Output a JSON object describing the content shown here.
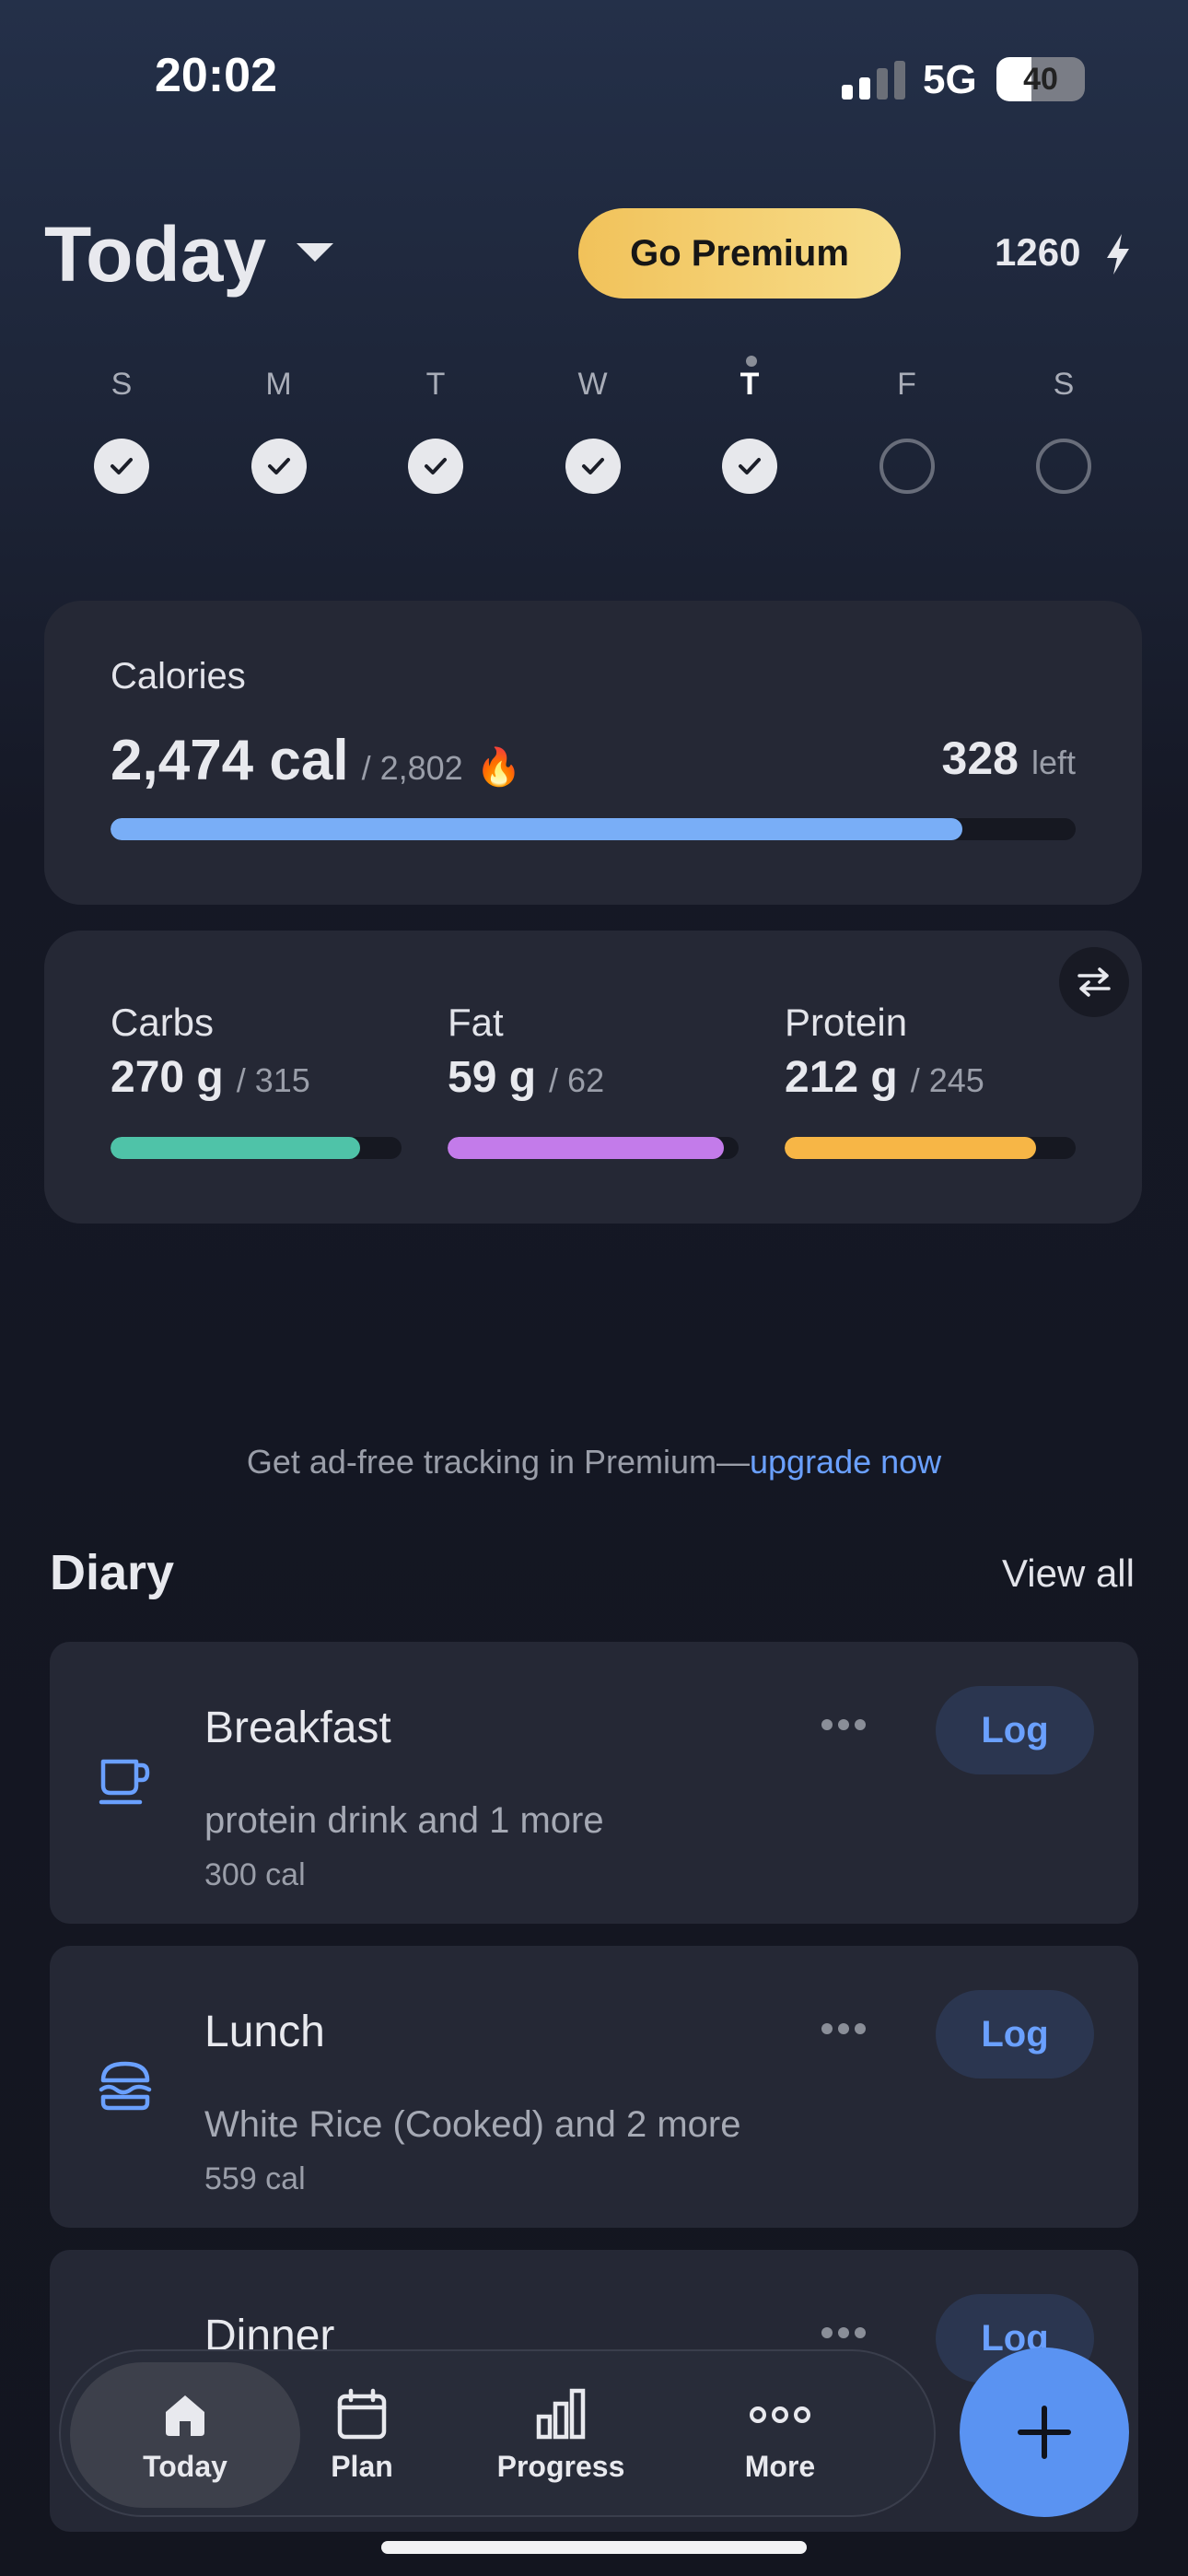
{
  "status_bar": {
    "time": "20:02",
    "network": "5G",
    "battery": "40",
    "battery_level": 0.4
  },
  "header": {
    "title": "Today",
    "premium_label": "Go Premium",
    "streak_count": "1260"
  },
  "week": {
    "days": [
      "S",
      "M",
      "T",
      "W",
      "T",
      "F",
      "S"
    ],
    "today_index": 4,
    "completed": [
      true,
      true,
      true,
      true,
      true,
      false,
      false
    ]
  },
  "calories": {
    "label": "Calories",
    "value": "2,474 cal",
    "goal": "/ 2,802",
    "icon": "flame-emoji",
    "left_value": "328",
    "left_label": "left",
    "progress": 0.883,
    "color": "#79aef7"
  },
  "macros": [
    {
      "name": "Carbs",
      "value": "270 g",
      "goal": "/ 315",
      "progress": 0.857,
      "color": "#4fc3a8"
    },
    {
      "name": "Fat",
      "value": "59 g",
      "goal": "/ 62",
      "progress": 0.95,
      "color": "#c37bea"
    },
    {
      "name": "Protein",
      "value": "212 g",
      "goal": "/ 245",
      "progress": 0.865,
      "color": "#f7b646"
    }
  ],
  "promo": {
    "text": "Get ad-free tracking in Premium—",
    "link": "upgrade now"
  },
  "diary": {
    "title": "Diary",
    "view_all": "View all",
    "meals": [
      {
        "name": "Breakfast",
        "desc": "protein drink and 1 more",
        "cal": "300 cal",
        "icon": "coffee-cup-icon",
        "log": "Log"
      },
      {
        "name": "Lunch",
        "desc": "White Rice (Cooked) and 2 more",
        "cal": "559 cal",
        "icon": "burger-icon",
        "log": "Log"
      },
      {
        "name": "Dinner",
        "desc": "",
        "cal": "",
        "icon": "dinner-icon",
        "log": "Log"
      }
    ]
  },
  "tabs": [
    {
      "label": "Today",
      "icon": "home-icon",
      "active": true
    },
    {
      "label": "Plan",
      "icon": "calendar-icon",
      "active": false
    },
    {
      "label": "Progress",
      "icon": "bar-chart-icon",
      "active": false
    },
    {
      "label": "More",
      "icon": "more-dots-icon",
      "active": false
    }
  ],
  "colors": {
    "accent": "#5a93f2",
    "link": "#6aa0ff",
    "premium": "#f4cf6f"
  }
}
